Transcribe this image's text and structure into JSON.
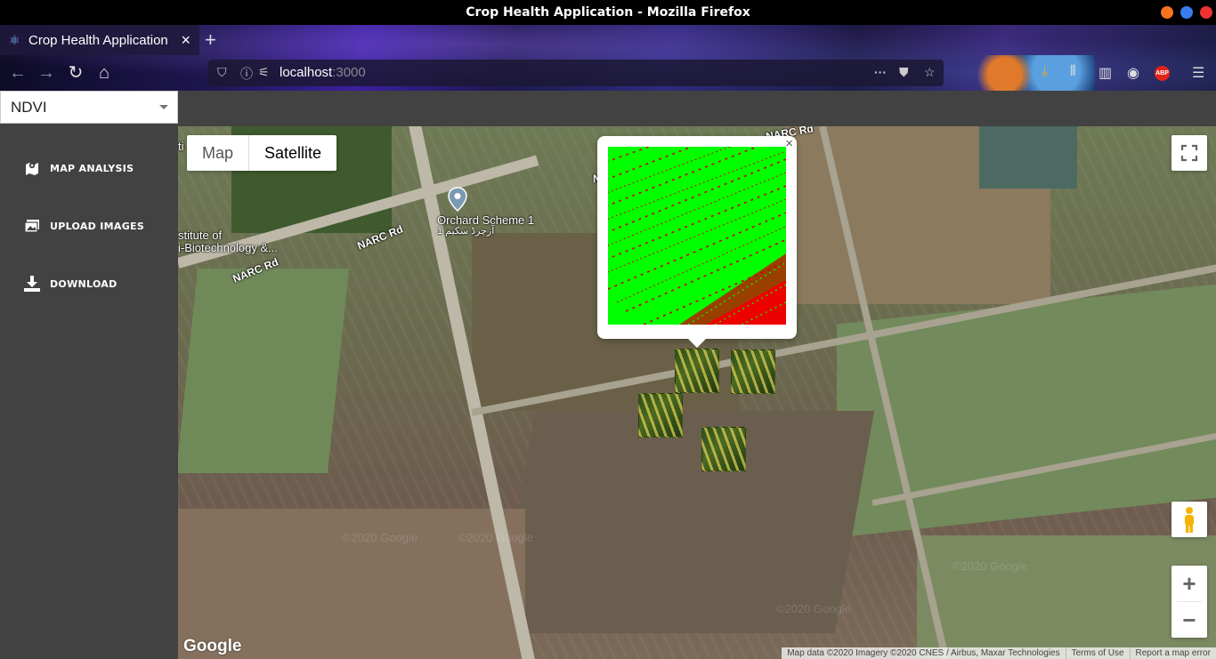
{
  "window": {
    "title": "Crop Health Application - Mozilla Firefox"
  },
  "browser": {
    "tab_title": "Crop Health Application",
    "url_host": "localhost",
    "url_port": ":3000"
  },
  "app": {
    "index_select": {
      "value": "NDVI"
    },
    "sidebar": {
      "items": [
        {
          "label": "MAP ANALYSIS",
          "icon": "map-marker-icon"
        },
        {
          "label": "UPLOAD IMAGES",
          "icon": "images-icon"
        },
        {
          "label": "DOWNLOAD",
          "icon": "download-icon"
        }
      ]
    },
    "map": {
      "type_buttons": {
        "map": "Map",
        "satellite": "Satellite",
        "active": "Satellite"
      },
      "roads": [
        "NARC Rd",
        "NARC Rd",
        "NARC Rd",
        "N"
      ],
      "place_name": "Orchard Scheme 1",
      "place_name_alt": "آرچرڈ سکیم 1",
      "institute_line1": "stitute of",
      "institute_line2": "i-Biotechnology &...",
      "institute_prefix": "ti",
      "watermarks": [
        "©2020 Google",
        "©2020 Google",
        "©2020 Google",
        "©2020 Google"
      ],
      "google_logo": "Google",
      "attribution": {
        "map_data": "Map data ©2020 Imagery ©2020 CNES / Airbus, Maxar Technologies",
        "terms": "Terms of Use",
        "report": "Report a map error"
      },
      "zoom_in": "+",
      "zoom_out": "−",
      "infowindow_close": "×"
    }
  },
  "colors": {
    "sidebar_bg": "#424242",
    "ndvi_healthy": "#00ff00",
    "ndvi_stressed": "#dd0000"
  }
}
